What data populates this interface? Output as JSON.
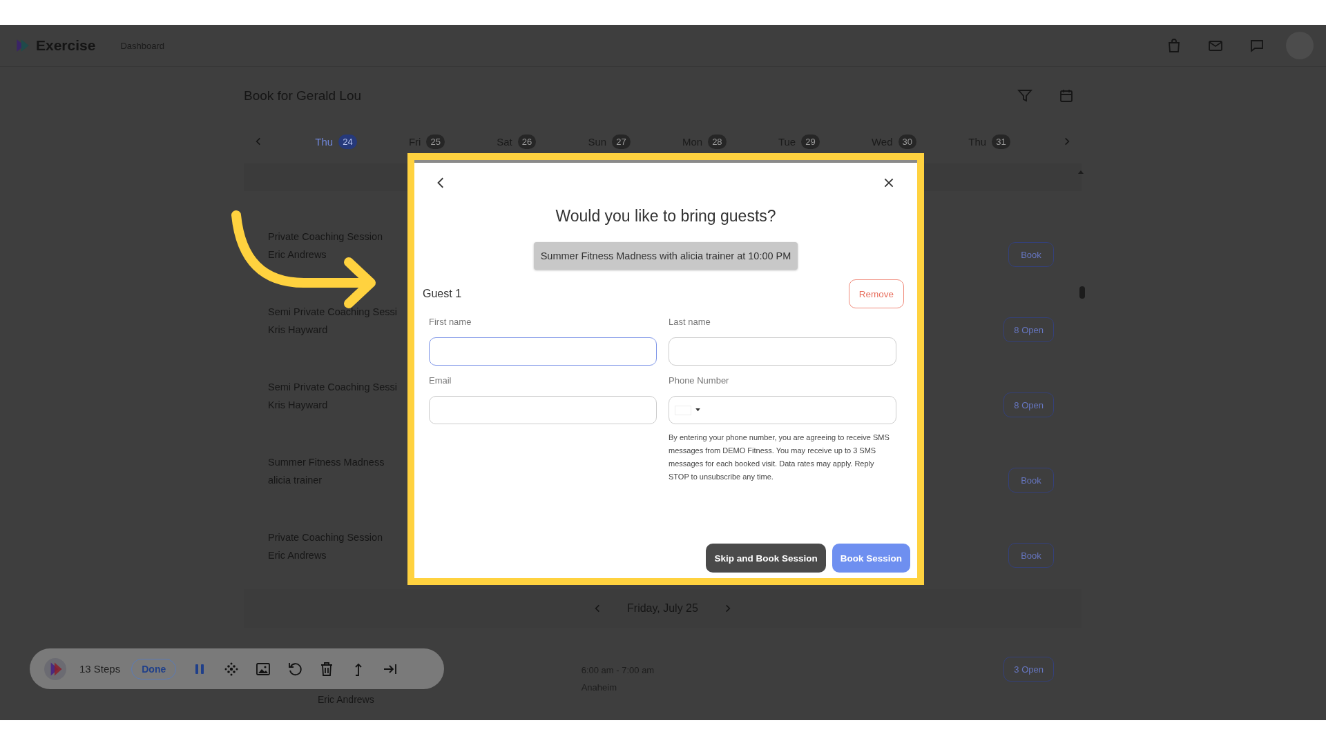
{
  "header": {
    "logo": "Exercise",
    "nav": "Dashboard"
  },
  "page": {
    "title": "Book for Gerald Lou"
  },
  "days": [
    {
      "day": "Thu",
      "date": "24",
      "selected": true
    },
    {
      "day": "Fri",
      "date": "25",
      "selected": false
    },
    {
      "day": "Sat",
      "date": "26",
      "selected": false
    },
    {
      "day": "Sun",
      "date": "27",
      "selected": false
    },
    {
      "day": "Mon",
      "date": "28",
      "selected": false
    },
    {
      "day": "Tue",
      "date": "29",
      "selected": false
    },
    {
      "day": "Wed",
      "date": "30",
      "selected": false
    },
    {
      "day": "Thu",
      "date": "31",
      "selected": false
    }
  ],
  "sessions": [
    {
      "name": "Private Coaching Session",
      "trainer": "Eric Andrews",
      "action": "Book"
    },
    {
      "name": "Semi Private Coaching Sessi",
      "trainer": "Kris Hayward",
      "action": "8 Open"
    },
    {
      "name": "Semi Private Coaching Sessi",
      "trainer": "Kris Hayward",
      "action": "8 Open"
    },
    {
      "name": "Summer Fitness Madness",
      "trainer": "alicia trainer",
      "action": "Book"
    },
    {
      "name": "Private Coaching Session",
      "trainer": "Eric Andrews",
      "action": "Book"
    }
  ],
  "next_day": {
    "label": "Friday, July 25"
  },
  "next_sessions": [
    {
      "trainer": "Eric Andrews",
      "time": "6:00 am - 7:00 am",
      "location": "Anaheim",
      "action": "3 Open"
    }
  ],
  "modal": {
    "title": "Would you like to bring guests?",
    "session": "Summer Fitness Madness with alicia trainer at 10:00 PM",
    "guests": [
      {
        "label": "Guest 1",
        "remove": "Remove",
        "fields": [
          {
            "label": "First name",
            "kind": "text",
            "focused": true
          },
          {
            "label": "Last name",
            "kind": "text",
            "focused": false
          },
          {
            "label": "Email",
            "kind": "text",
            "focused": false
          },
          {
            "label": "Phone Number",
            "kind": "phone",
            "focused": false
          }
        ]
      }
    ],
    "disclaimer": "By entering your phone number, you are agreeing to receive SMS messages from DEMO Fitness. You may receive up to 3 SMS messages for each booked visit. Data rates may apply. Reply STOP to unsubscribe any time.",
    "buttons": [
      {
        "label": "Skip and Book Session",
        "kind": "secondary"
      },
      {
        "label": "Book Session",
        "kind": "primary"
      }
    ]
  },
  "toolbar": {
    "steps": "13 Steps",
    "done": "Done"
  }
}
